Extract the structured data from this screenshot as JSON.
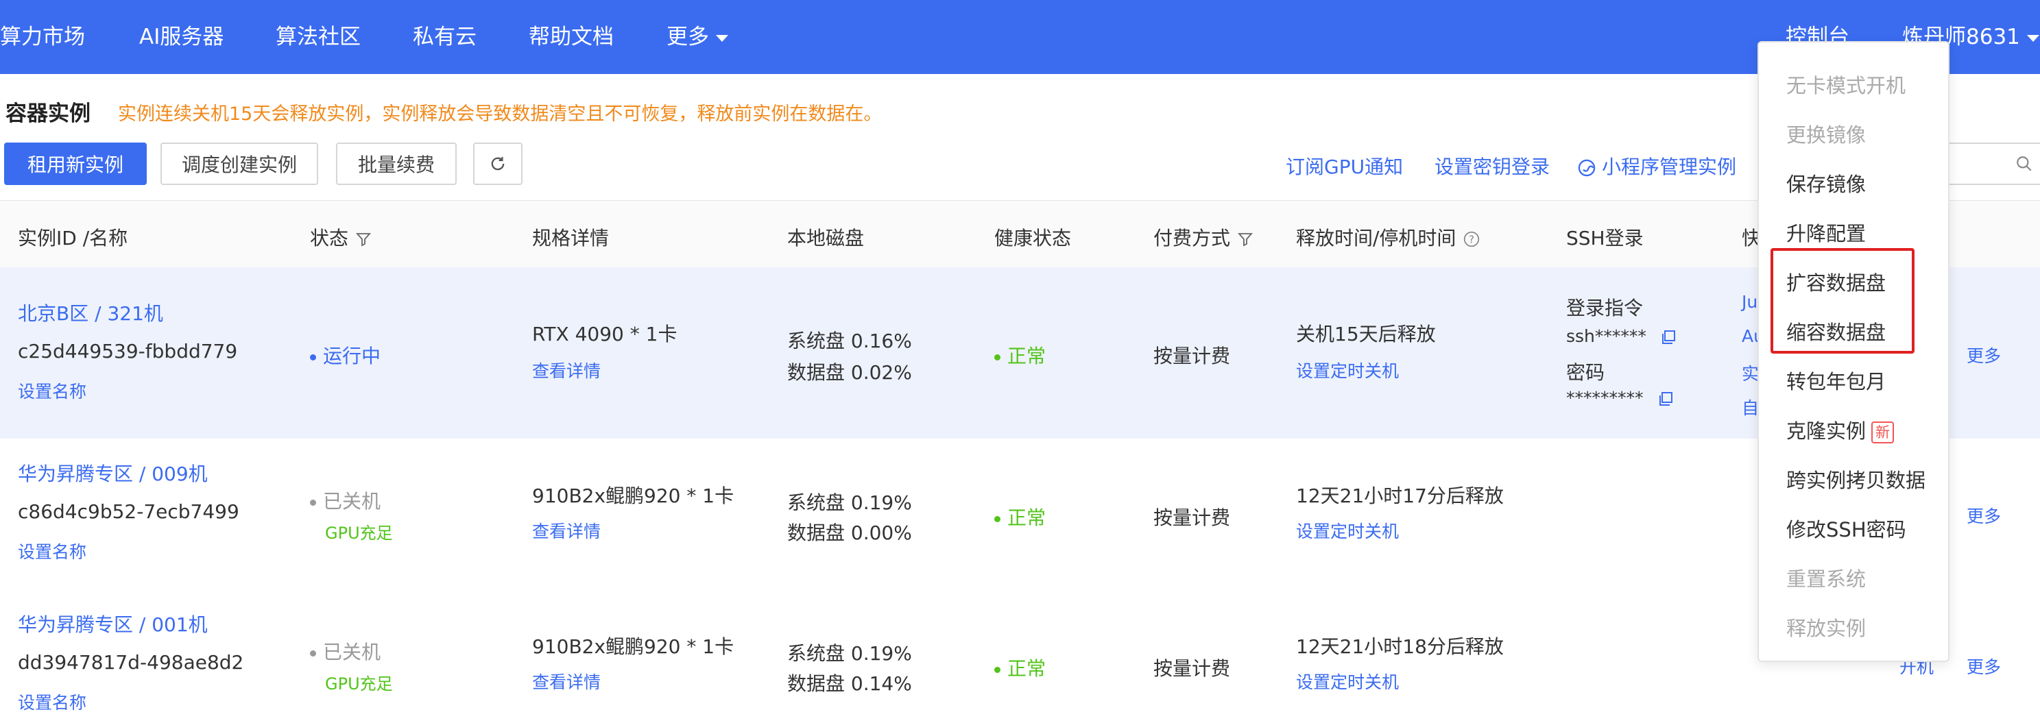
{
  "nav": {
    "items": [
      "算力市场",
      "AI服务器",
      "算法社区",
      "私有云",
      "帮助文档",
      "更多"
    ],
    "console": "控制台",
    "user": "炼丹师8631"
  },
  "page": {
    "title": "容器实例",
    "warning": "实例连续关机15天会释放实例，实例释放会导致数据清空且不可恢复，释放前实例在数据在。"
  },
  "toolbar": {
    "rent_new": "租用新实例",
    "schedule_create": "调度创建实例",
    "batch_renew": "批量续费",
    "subscribe_gpu": "订阅GPU通知",
    "set_key_login": "设置密钥登录",
    "miniapp_manage": "小程序管理实例"
  },
  "table": {
    "headers": {
      "id_name": "实例ID /名称",
      "status": "状态",
      "spec": "规格详情",
      "disk": "本地磁盘",
      "health": "健康状态",
      "billing": "付费方式",
      "release": "释放时间/停机时间",
      "ssh": "SSH登录",
      "shortcut": "快"
    },
    "rows": [
      {
        "name": "北京B区 / 321机",
        "id": "c25d449539-fbbdd779",
        "set_name": "设置名称",
        "status": "运行中",
        "status_sub": "",
        "spec": "RTX 4090 * 1卡",
        "spec_link": "查看详情",
        "sys_disk": "系统盘 0.16%",
        "data_disk": "数据盘 0.02%",
        "health": "正常",
        "billing": "按量计费",
        "release": "关机15天后释放",
        "release_link": "设置定时关机",
        "ssh_cmd_label": "登录指令",
        "ssh_user": "ssh******",
        "ssh_pwd_label": "密码",
        "ssh_pwd": "*********",
        "shortcuts": [
          "Ju",
          "Au",
          "实",
          "自"
        ],
        "action": "",
        "more": "更多"
      },
      {
        "name": "华为昇腾专区 / 009机",
        "id": "c86d4c9b52-7ecb7499",
        "set_name": "设置名称",
        "status": "已关机",
        "status_sub": "GPU充足",
        "spec": "910B2x鲲鹏920 * 1卡",
        "spec_link": "查看详情",
        "sys_disk": "系统盘 0.19%",
        "data_disk": "数据盘 0.00%",
        "health": "正常",
        "billing": "按量计费",
        "release": "12天21小时17分后释放",
        "release_link": "设置定时关机",
        "action": "",
        "more": "更多"
      },
      {
        "name": "华为昇腾专区 / 001机",
        "id": "dd3947817d-498ae8d2",
        "set_name": "设置名称",
        "status": "已关机",
        "status_sub": "GPU充足",
        "spec": "910B2x鲲鹏920 * 1卡",
        "spec_link": "查看详情",
        "sys_disk": "系统盘 0.19%",
        "data_disk": "数据盘 0.14%",
        "health": "正常",
        "billing": "按量计费",
        "release": "12天21小时18分后释放",
        "release_link": "设置定时关机",
        "action": "开机",
        "more": "更多"
      }
    ]
  },
  "menu": {
    "items": [
      {
        "label": "无卡模式开机",
        "disabled": true
      },
      {
        "label": "更换镜像",
        "disabled": true
      },
      {
        "label": "保存镜像",
        "disabled": false
      },
      {
        "label": "升降配置",
        "disabled": false
      },
      {
        "label": "扩容数据盘",
        "disabled": false
      },
      {
        "label": "缩容数据盘",
        "disabled": false
      },
      {
        "label": "转包年包月",
        "disabled": false
      },
      {
        "label": "克隆实例",
        "disabled": false
      },
      {
        "label": "跨实例拷贝数据",
        "disabled": false
      },
      {
        "label": "修改SSH密码",
        "disabled": false
      },
      {
        "label": "重置系统",
        "disabled": true
      },
      {
        "label": "释放实例",
        "disabled": true
      }
    ],
    "new_badge": "新"
  },
  "colors": {
    "primary": "#3b6cf0",
    "warning": "#f08a1c",
    "success": "#52c41a",
    "highlight_box": "#e02020",
    "selected_row": "#eef2fc"
  }
}
